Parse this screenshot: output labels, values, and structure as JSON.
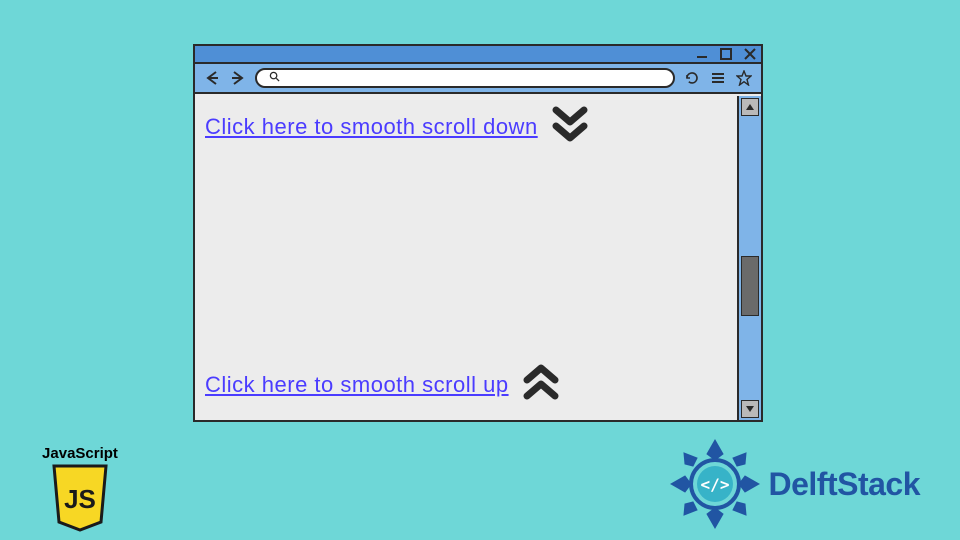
{
  "window": {
    "link_down": "Click here to smooth scroll down",
    "link_up": "Click here to smooth scroll up"
  },
  "badges": {
    "js_label": "JavaScript",
    "js_shield": "JS",
    "delft_name": "DelftStack"
  },
  "icons": {
    "minimize": "minimize",
    "maximize": "maximize",
    "close": "close",
    "back": "back",
    "forward": "forward",
    "search": "search",
    "reload": "reload",
    "menu": "menu",
    "star": "star"
  },
  "colors": {
    "bg": "#6ed7d7",
    "titlebar": "#4f8fd6",
    "toolbar": "#7fb4e8",
    "link": "#4b3cff",
    "delft": "#2155a3",
    "jsYellow": "#f7d724"
  }
}
